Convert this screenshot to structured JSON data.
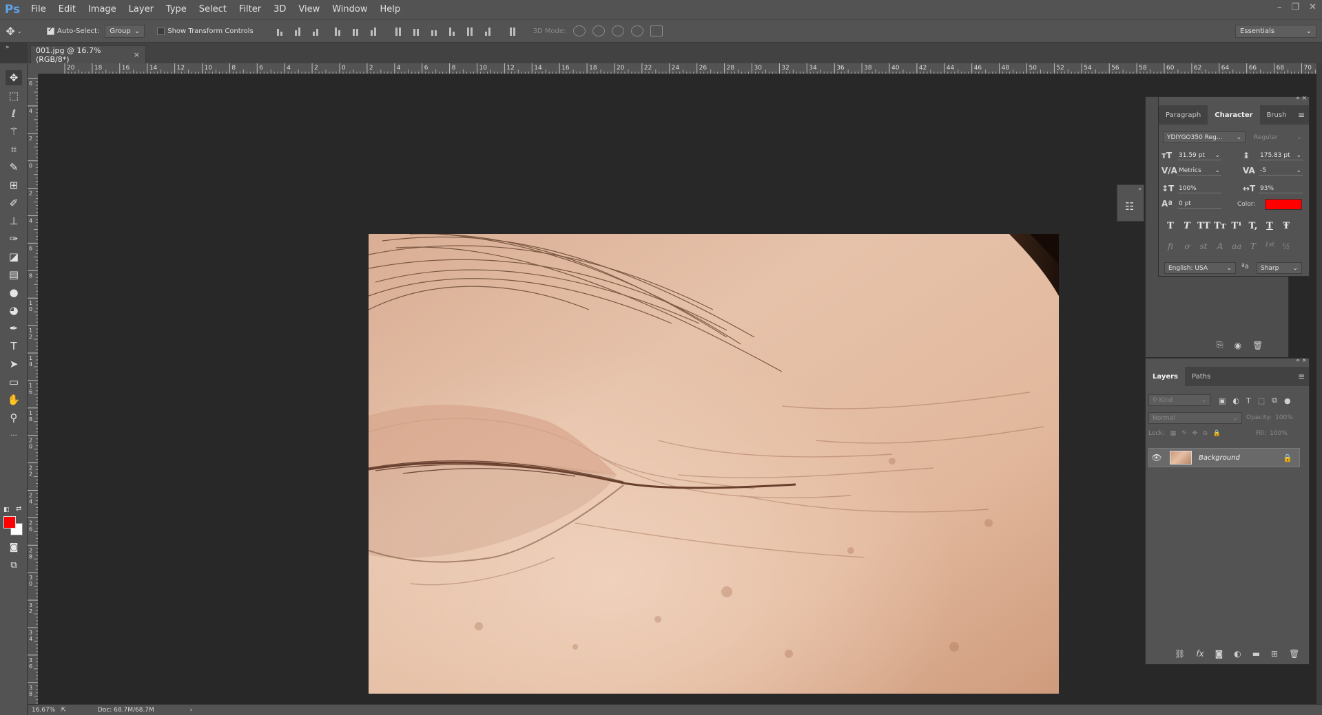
{
  "app": {
    "logo": "Ps",
    "menu": [
      "File",
      "Edit",
      "Image",
      "Layer",
      "Type",
      "Select",
      "Filter",
      "3D",
      "View",
      "Window",
      "Help"
    ],
    "window_controls": [
      "–",
      "❐",
      "✕"
    ]
  },
  "options_bar": {
    "auto_select_label": "Auto-Select:",
    "auto_select_checked": true,
    "auto_select_target": "Group",
    "show_transform_label": "Show Transform Controls",
    "show_transform_checked": false,
    "mode_3d_label": "3D Mode:",
    "workspace": "Essentials"
  },
  "document": {
    "tab_title": "001.jpg @ 16.7% (RGB/8*)",
    "close_glyph": "×",
    "zoom": "16.67%",
    "doc_size": "Doc: 68.7M/68.7M",
    "status_arrow": "›"
  },
  "rulers": {
    "horizontal": [
      "20",
      "18",
      "16",
      "14",
      "12",
      "10",
      "8",
      "6",
      "4",
      "2",
      "0",
      "2",
      "4",
      "6",
      "8",
      "10",
      "12",
      "14",
      "16",
      "18",
      "20",
      "22",
      "24",
      "26",
      "28",
      "30",
      "32",
      "34",
      "36",
      "38",
      "40",
      "42",
      "44",
      "46",
      "48",
      "50",
      "52",
      "54",
      "56",
      "58",
      "60",
      "62",
      "64",
      "66",
      "68",
      "70"
    ],
    "vertical": [
      "6",
      "4",
      "2",
      "0",
      "2",
      "4",
      "6",
      "8",
      "10",
      "12",
      "14",
      "16",
      "18",
      "20",
      "22",
      "24",
      "26",
      "28",
      "30",
      "32",
      "34",
      "36",
      "38"
    ]
  },
  "tools": [
    {
      "name": "move-tool",
      "glyph": "✥"
    },
    {
      "name": "marquee-tool",
      "glyph": "⬚"
    },
    {
      "name": "lasso-tool",
      "glyph": "ℓ"
    },
    {
      "name": "magic-wand-tool",
      "glyph": "⚚"
    },
    {
      "name": "crop-tool",
      "glyph": "⌗"
    },
    {
      "name": "eyedropper-tool",
      "glyph": "✎"
    },
    {
      "name": "healing-brush-tool",
      "glyph": "⊞"
    },
    {
      "name": "brush-tool",
      "glyph": "✐"
    },
    {
      "name": "clone-stamp-tool",
      "glyph": "⊥"
    },
    {
      "name": "history-brush-tool",
      "glyph": "✑"
    },
    {
      "name": "eraser-tool",
      "glyph": "◪"
    },
    {
      "name": "gradient-tool",
      "glyph": "▤"
    },
    {
      "name": "blur-tool",
      "glyph": "●"
    },
    {
      "name": "dodge-tool",
      "glyph": "◕"
    },
    {
      "name": "pen-tool",
      "glyph": "✒"
    },
    {
      "name": "type-tool",
      "glyph": "T"
    },
    {
      "name": "path-selection-tool",
      "glyph": "➤"
    },
    {
      "name": "shape-tool",
      "glyph": "▭"
    },
    {
      "name": "hand-tool",
      "glyph": "✋"
    },
    {
      "name": "zoom-tool",
      "glyph": "⚲"
    },
    {
      "name": "more-tools",
      "glyph": "···"
    }
  ],
  "colors": {
    "foreground": "#ff0000",
    "background": "#ffffff",
    "char_color": "#ff0000"
  },
  "character_panel": {
    "tabs": [
      "Paragraph",
      "Character",
      "Brush"
    ],
    "active_tab": "Character",
    "font_family": "YDIYGO350 Reg...",
    "font_style": "Regular",
    "size": "31.59 pt",
    "leading": "175.83 pt",
    "kerning": "Metrics",
    "tracking": "-5",
    "vertical_scale": "100%",
    "horizontal_scale": "93%",
    "baseline_shift": "0 pt",
    "color_label": "Color:",
    "type_styles": [
      "T",
      "T",
      "TT",
      "Tт",
      "T¹",
      "T,",
      "T",
      "Ŧ"
    ],
    "opentype": [
      "fi",
      "ơ",
      "st",
      "A",
      "aa",
      "T",
      "1st",
      "½"
    ],
    "language": "English: USA",
    "antialias": "Sharp"
  },
  "layers_panel": {
    "tabs": [
      "Layers",
      "Paths"
    ],
    "active_tab": "Layers",
    "filter_placeholder": "Kind",
    "blend_mode": "Normal",
    "opacity_label": "Opacity:",
    "opacity": "100%",
    "lock_label": "Lock:",
    "fill_label": "Fill:",
    "fill": "100%",
    "layers": [
      {
        "name": "Background",
        "visible": true,
        "locked": true
      }
    ],
    "footer": [
      "link-icon",
      "fx-icon",
      "mask-icon",
      "adjustment-icon",
      "folder-icon",
      "new-layer-icon",
      "trash-icon"
    ]
  }
}
